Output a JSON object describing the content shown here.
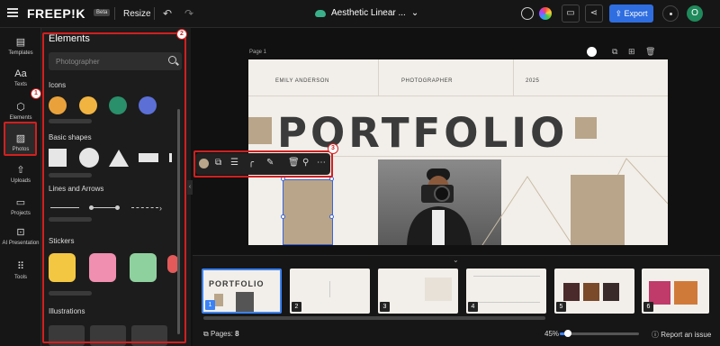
{
  "header": {
    "logo": "FREEP!K",
    "beta": "Beta",
    "resize": "Resize",
    "doc_title": "Aesthetic Linear ...",
    "export": "Export",
    "avatar": "O"
  },
  "rail": {
    "items": [
      {
        "label": "Templates",
        "icon": "templates-icon"
      },
      {
        "label": "Texts",
        "icon": "text-icon"
      },
      {
        "label": "Elements",
        "icon": "shapes-icon"
      },
      {
        "label": "Photos",
        "icon": "photo-icon"
      },
      {
        "label": "Uploads",
        "icon": "upload-icon"
      },
      {
        "label": "Projects",
        "icon": "folder-icon"
      },
      {
        "label": "AI Presentation",
        "icon": "ai-presentation-icon"
      },
      {
        "label": "Tools",
        "icon": "grid-icon"
      }
    ]
  },
  "panel": {
    "title": "Elements",
    "search_placeholder": "Photographer",
    "sections": [
      "Icons",
      "Basic shapes",
      "Lines and Arrows",
      "Stickers",
      "Illustrations"
    ]
  },
  "annotations": {
    "one": "1",
    "two": "2",
    "three": "3"
  },
  "canvas": {
    "page_label": "Page 1",
    "name": "EMILY ANDERSON",
    "role": "PHOTOGRAPHER",
    "year": "2025",
    "headline": "PORTFOLIO"
  },
  "thumbnails": [
    {
      "num": "1",
      "active": true
    },
    {
      "num": "2",
      "active": false
    },
    {
      "num": "3",
      "active": false
    },
    {
      "num": "4",
      "active": false
    },
    {
      "num": "5",
      "active": false
    },
    {
      "num": "6",
      "active": false
    }
  ],
  "footer": {
    "pages_label": "Pages:",
    "pages_count": "8",
    "zoom": "45%",
    "zoom_fraction": 0.1,
    "report": "Report an issue"
  },
  "colors": {
    "accent": "#2f6ee0",
    "annotation": "#d21f1f",
    "tan": "#b9a589"
  }
}
